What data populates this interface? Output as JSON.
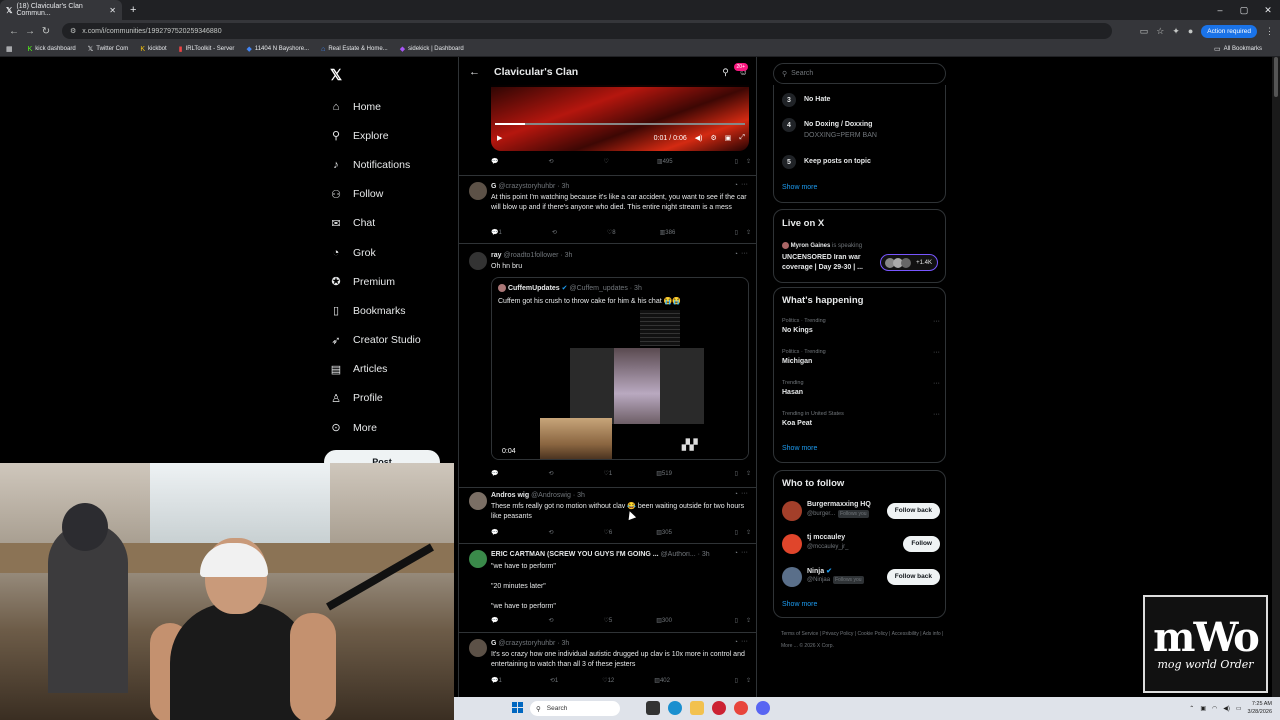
{
  "browser": {
    "tab_title": "(18) Clavicular's Clan Commun...",
    "url": "x.com/i/communities/1992797520259346880",
    "action_required": "Action required",
    "bookmarks": [
      "kick dashboard",
      "Twitter Com",
      "kickbot",
      "IRLToolkit - Server",
      "11404 N Bayshore...",
      "Real Estate & Home...",
      "sidekick | Dashboard"
    ],
    "all_bookmarks": "All Bookmarks"
  },
  "nav": {
    "items": [
      {
        "label": "Home",
        "icon": "home-icon"
      },
      {
        "label": "Explore",
        "icon": "search-icon"
      },
      {
        "label": "Notifications",
        "icon": "bell-icon"
      },
      {
        "label": "Follow",
        "icon": "follow-icon"
      },
      {
        "label": "Chat",
        "icon": "mail-icon"
      },
      {
        "label": "Grok",
        "icon": "grok-icon"
      },
      {
        "label": "Premium",
        "icon": "premium-icon"
      },
      {
        "label": "Bookmarks",
        "icon": "bookmark-icon"
      },
      {
        "label": "Creator Studio",
        "icon": "rocket-icon"
      },
      {
        "label": "Articles",
        "icon": "articles-icon"
      },
      {
        "label": "Profile",
        "icon": "profile-icon"
      },
      {
        "label": "More",
        "icon": "more-icon"
      }
    ],
    "post_label": "Post"
  },
  "community": {
    "title": "Clavicular's Clan",
    "badge": "20+",
    "video_time": "0:01 / 0:06",
    "posts": [
      {
        "stats": {
          "reply": "",
          "repost": "",
          "like": "",
          "views": "495"
        }
      },
      {
        "name": "G",
        "handle": "@crazystoryhuhbr",
        "time": "· 3h",
        "text": "At this point I'm watching because it's like a car accident, you want to see if the car will blow up and if there's anyone who died. This entire night stream is a mess",
        "stats": {
          "reply": "1",
          "repost": "",
          "like": "8",
          "views": "386"
        }
      },
      {
        "name": "ray",
        "handle": "@roadto1follower",
        "time": "· 3h",
        "text": "Oh hn bru",
        "quote": {
          "name": "CuffemUpdates",
          "handle": "@Cuffem_updates",
          "time": "· 3h",
          "text": "Cuffem got his crush to throw cake for him & his chat 😭😭",
          "video_time": "0:04"
        },
        "stats": {
          "reply": "",
          "repost": "",
          "like": "1",
          "views": "519"
        }
      },
      {
        "name": "Andros wig",
        "handle": "@Androswig",
        "time": "· 3h",
        "text": "These mfs really got no motion without clav 😂 been waiting outside for two hours like peasants",
        "stats": {
          "reply": "",
          "repost": "",
          "like": "6",
          "views": "305"
        }
      },
      {
        "name": "ERIC CARTMAN (SCREW YOU GUYS I'M GOING ...",
        "handle": "@Authori...",
        "time": "· 3h",
        "text": "\"we have to perform\"\n\n\"20 minutes later\"\n\n\"we have to perform\"",
        "stats": {
          "reply": "",
          "repost": "",
          "like": "5",
          "views": "300"
        }
      },
      {
        "name": "G",
        "handle": "@crazystoryhuhbr",
        "time": "· 3h",
        "text": "It's so crazy how one individual autistic drugged up clav is 10x more in control and entertaining to watch than all 3 of these jesters",
        "stats": {
          "reply": "1",
          "repost": "1",
          "like": "12",
          "views": "402"
        }
      }
    ]
  },
  "sidebar": {
    "search_placeholder": "Search",
    "rules": [
      {
        "num": "3",
        "title": "No Hate",
        "sub": ""
      },
      {
        "num": "4",
        "title": "No Doxing / Doxxing",
        "sub": "DOXXING=PERM BAN"
      },
      {
        "num": "5",
        "title": "Keep posts on topic",
        "sub": ""
      }
    ],
    "show_more": "Show more",
    "live": {
      "heading": "Live on X",
      "speaker": "Myron Gaines",
      "speaking": "is speaking",
      "title": "UNCENSORED Iran war coverage | Day 29-30 | ...",
      "count": "+1.4K"
    },
    "happening": {
      "heading": "What's happening",
      "trends": [
        {
          "meta": "Politics · Trending",
          "name": "No Kings"
        },
        {
          "meta": "Politics · Trending",
          "name": "Michigan"
        },
        {
          "meta": "Trending",
          "name": "Hasan"
        },
        {
          "meta": "Trending in United States",
          "name": "Koa Peat"
        }
      ]
    },
    "who": {
      "heading": "Who to follow",
      "users": [
        {
          "name": "Burgermaxxing HQ",
          "handle": "@burger...",
          "follows_you": "Follows you",
          "button": "Follow back",
          "color": "#a33f2a"
        },
        {
          "name": "tj mccauley",
          "handle": "@mccauley_jr_",
          "follows_you": "",
          "button": "Follow",
          "color": "#e0452b"
        },
        {
          "name": "Ninja",
          "handle": "@Ninjaa",
          "follows_you": "Follows you",
          "button": "Follow back",
          "color": "#5a6f8a"
        }
      ]
    },
    "footer": "Terms of Service | Privacy Policy | Cookie Policy | Accessibility | Ads info | More ... © 2026 X Corp."
  },
  "overlay": {
    "logo_big": "mWo",
    "logo_small": "mog world Order"
  },
  "taskbar": {
    "search": "Search",
    "time": "7:25 AM",
    "date": "3/28/2026"
  }
}
